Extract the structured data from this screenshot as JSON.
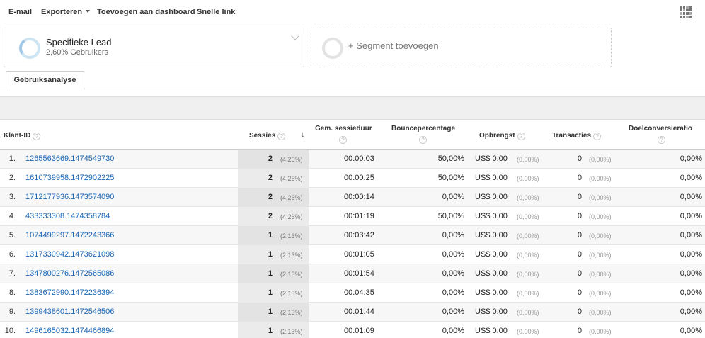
{
  "toolbar": {
    "email": "E-mail",
    "export": "Exporteren",
    "add_dashboard": "Toevoegen aan dashboard",
    "quick_link": "Snelle link"
  },
  "segments": {
    "active": {
      "title": "Specifieke Lead",
      "subtitle": "2,60% Gebruikers"
    },
    "add": "+ Segment toevoegen"
  },
  "tab": "Gebruiksanalyse",
  "columns": {
    "client_id": "Klant-ID",
    "sessions": "Sessies",
    "avg_duration": "Gem. sessieduur",
    "bounce": "Bouncepercentage",
    "revenue": "Opbrengst",
    "transactions": "Transacties",
    "goal_conv": "Doelconversieratio"
  },
  "help_glyph": "?",
  "sort_glyph": "↓",
  "rows": [
    {
      "idx": "1.",
      "id": "1265563669.1474549730",
      "sessions": "2",
      "sessions_pct": "(4,26%)",
      "duration": "00:00:03",
      "bounce": "50,00%",
      "revenue": "US$ 0,00",
      "revenue_pct": "(0,00%)",
      "transactions": "0",
      "transactions_pct": "(0,00%)",
      "goal": "0,00%"
    },
    {
      "idx": "2.",
      "id": "1610739958.1472902225",
      "sessions": "2",
      "sessions_pct": "(4,26%)",
      "duration": "00:00:25",
      "bounce": "50,00%",
      "revenue": "US$ 0,00",
      "revenue_pct": "(0,00%)",
      "transactions": "0",
      "transactions_pct": "(0,00%)",
      "goal": "0,00%"
    },
    {
      "idx": "3.",
      "id": "1712177936.1473574090",
      "sessions": "2",
      "sessions_pct": "(4,26%)",
      "duration": "00:00:14",
      "bounce": "0,00%",
      "revenue": "US$ 0,00",
      "revenue_pct": "(0,00%)",
      "transactions": "0",
      "transactions_pct": "(0,00%)",
      "goal": "0,00%"
    },
    {
      "idx": "4.",
      "id": "433333308.1474358784",
      "sessions": "2",
      "sessions_pct": "(4,26%)",
      "duration": "00:01:19",
      "bounce": "50,00%",
      "revenue": "US$ 0,00",
      "revenue_pct": "(0,00%)",
      "transactions": "0",
      "transactions_pct": "(0,00%)",
      "goal": "0,00%"
    },
    {
      "idx": "5.",
      "id": "1074499297.1472243366",
      "sessions": "1",
      "sessions_pct": "(2,13%)",
      "duration": "00:03:42",
      "bounce": "0,00%",
      "revenue": "US$ 0,00",
      "revenue_pct": "(0,00%)",
      "transactions": "0",
      "transactions_pct": "(0,00%)",
      "goal": "0,00%"
    },
    {
      "idx": "6.",
      "id": "1317330942.1473621098",
      "sessions": "1",
      "sessions_pct": "(2,13%)",
      "duration": "00:01:05",
      "bounce": "0,00%",
      "revenue": "US$ 0,00",
      "revenue_pct": "(0,00%)",
      "transactions": "0",
      "transactions_pct": "(0,00%)",
      "goal": "0,00%"
    },
    {
      "idx": "7.",
      "id": "1347800276.1472565086",
      "sessions": "1",
      "sessions_pct": "(2,13%)",
      "duration": "00:01:54",
      "bounce": "0,00%",
      "revenue": "US$ 0,00",
      "revenue_pct": "(0,00%)",
      "transactions": "0",
      "transactions_pct": "(0,00%)",
      "goal": "0,00%"
    },
    {
      "idx": "8.",
      "id": "1383672990.1472236394",
      "sessions": "1",
      "sessions_pct": "(2,13%)",
      "duration": "00:04:35",
      "bounce": "0,00%",
      "revenue": "US$ 0,00",
      "revenue_pct": "(0,00%)",
      "transactions": "0",
      "transactions_pct": "(0,00%)",
      "goal": "0,00%"
    },
    {
      "idx": "9.",
      "id": "1399438601.1472546506",
      "sessions": "1",
      "sessions_pct": "(2,13%)",
      "duration": "00:01:44",
      "bounce": "0,00%",
      "revenue": "US$ 0,00",
      "revenue_pct": "(0,00%)",
      "transactions": "0",
      "transactions_pct": "(0,00%)",
      "goal": "0,00%"
    },
    {
      "idx": "10.",
      "id": "1496165032.1474466894",
      "sessions": "1",
      "sessions_pct": "(2,13%)",
      "duration": "00:01:09",
      "bounce": "0,00%",
      "revenue": "US$ 0,00",
      "revenue_pct": "(0,00%)",
      "transactions": "0",
      "transactions_pct": "(0,00%)",
      "goal": "0,00%"
    }
  ]
}
